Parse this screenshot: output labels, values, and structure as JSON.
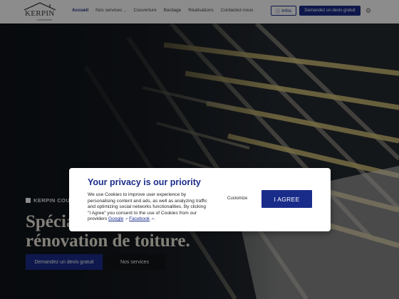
{
  "brand": {
    "name": "KERPIN",
    "subtitle": "couvertures"
  },
  "nav": {
    "items": [
      {
        "label": "Accueil",
        "active": true
      },
      {
        "label": "Nos services",
        "has_dropdown": true
      },
      {
        "label": "Couverture"
      },
      {
        "label": "Bardage"
      },
      {
        "label": "Réalisations"
      },
      {
        "label": "Contactez-nous"
      }
    ],
    "infos_label": "Infos",
    "quote_label": "Demandez un devis gratuit"
  },
  "hero": {
    "eyebrow": "KERPIN COUVERTURES",
    "title_line1": "Spécialiste de la",
    "title_line2": "rénovation de toiture.",
    "primary_button": "Demandez un devis gratuit",
    "secondary_button": "Nos services"
  },
  "cookie_modal": {
    "title": "Your privacy is our priority",
    "body": "We use Cookies to improve user experience by personalising content and ads, as well as analyzing traffic and optimizing social networks functionalities. By clicking \"I Agree\" you consent to the use of Cookies from our providers",
    "google_link": "Google",
    "facebook_link": "Facebook",
    "customize_label": "Customize",
    "agree_label": "I AGREE"
  },
  "colors": {
    "accent": "#1a2c8a",
    "beam": "#d9c77a",
    "hero_title": "#efe9dc"
  },
  "icons": {
    "infos": "info-icon",
    "settings": "gear-icon",
    "external": "external-link-icon"
  }
}
